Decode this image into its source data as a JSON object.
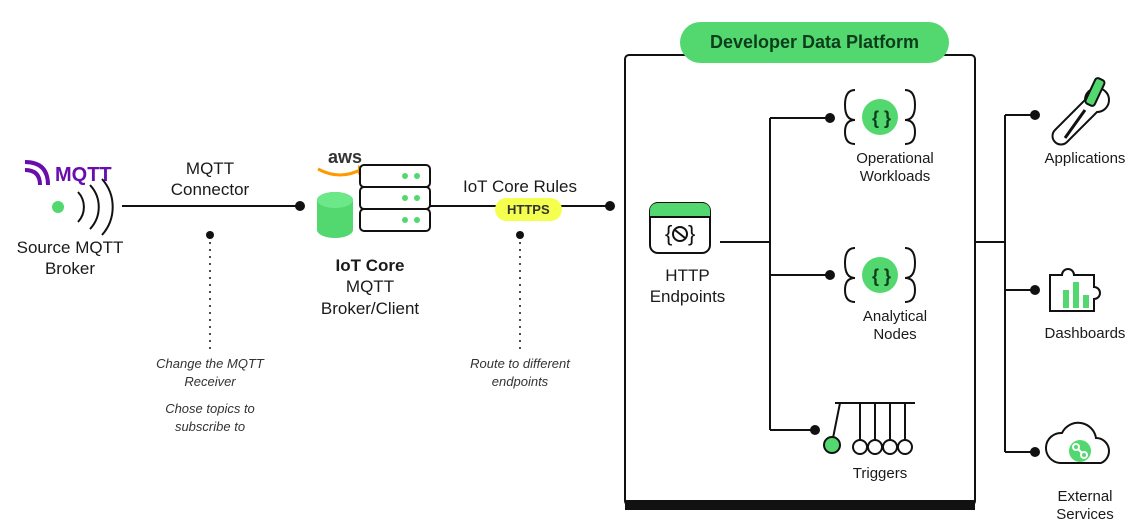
{
  "nodes": {
    "mqtt_logo_text": "MQTT",
    "source_broker": "Source MQTT\nBroker",
    "connector_label": "MQTT\nConnector",
    "iot_core_title": "IoT Core",
    "iot_core_sub": "MQTT\nBroker/Client",
    "aws_label": "aws",
    "rules_label": "IoT Core Rules",
    "https_label": "HTTPS",
    "http_endpoints": "HTTP\nEndpoints",
    "op_workloads": "Operational\nWorkloads",
    "analytical_nodes": "Analytical\nNodes",
    "triggers": "Triggers",
    "applications": "Applications",
    "dashboards": "Dashboards",
    "external_services": "External\nServices",
    "platform_title": "Developer Data Platform"
  },
  "notes": {
    "change_receiver": "Change the MQTT\nReceiver",
    "choose_topics": "Chose topics to\nsubscribe to",
    "route_endpoints": "Route to different\nendpoints"
  },
  "colors": {
    "green": "#52d86f",
    "darkgreen": "#0d3d1b",
    "yellow": "#f5ff4d",
    "stroke": "#111",
    "purple": "#6a0dad",
    "orange": "#ff9900"
  }
}
